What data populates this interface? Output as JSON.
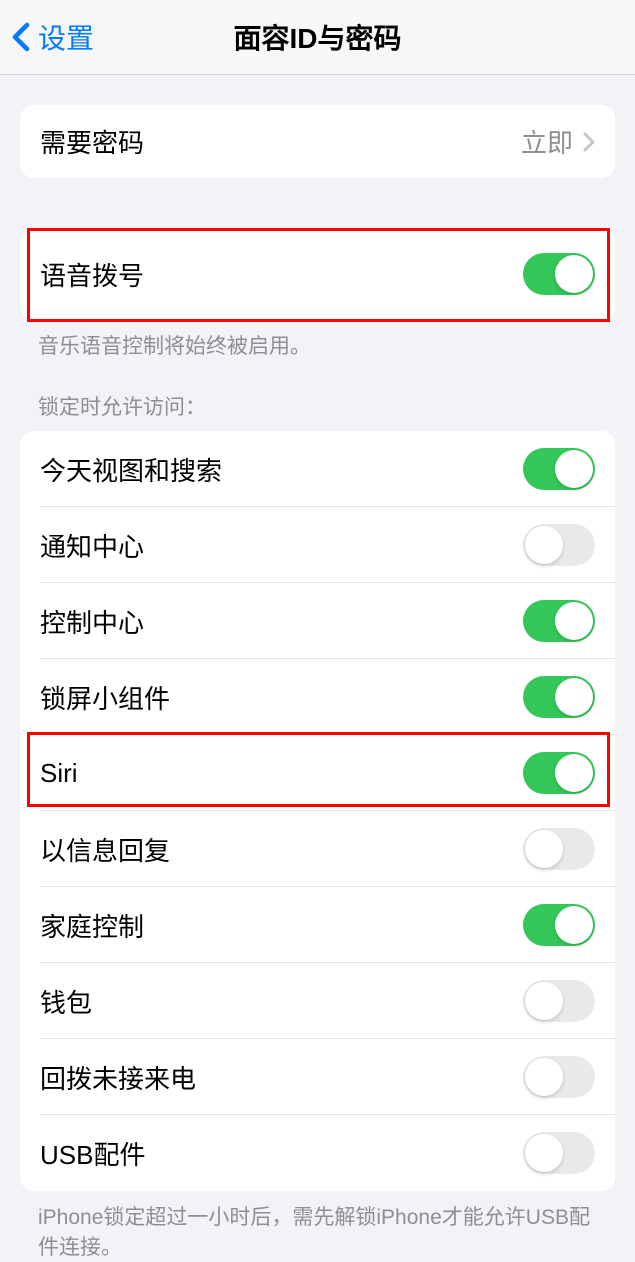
{
  "header": {
    "back_label": "设置",
    "title": "面容ID与密码"
  },
  "require_passcode": {
    "label": "需要密码",
    "value": "立即"
  },
  "voice_dial": {
    "label": "语音拨号",
    "enabled": true,
    "footer": "音乐语音控制将始终被启用。"
  },
  "lock_access": {
    "header": "锁定时允许访问：",
    "items": [
      {
        "label": "今天视图和搜索",
        "enabled": true
      },
      {
        "label": "通知中心",
        "enabled": false
      },
      {
        "label": "控制中心",
        "enabled": true
      },
      {
        "label": "锁屏小组件",
        "enabled": true
      },
      {
        "label": "Siri",
        "enabled": true
      },
      {
        "label": "以信息回复",
        "enabled": false
      },
      {
        "label": "家庭控制",
        "enabled": true
      },
      {
        "label": "钱包",
        "enabled": false
      },
      {
        "label": "回拨未接来电",
        "enabled": false
      },
      {
        "label": "USB配件",
        "enabled": false
      }
    ],
    "footer": "iPhone锁定超过一小时后，需先解锁iPhone才能允许USB配件连接。"
  }
}
